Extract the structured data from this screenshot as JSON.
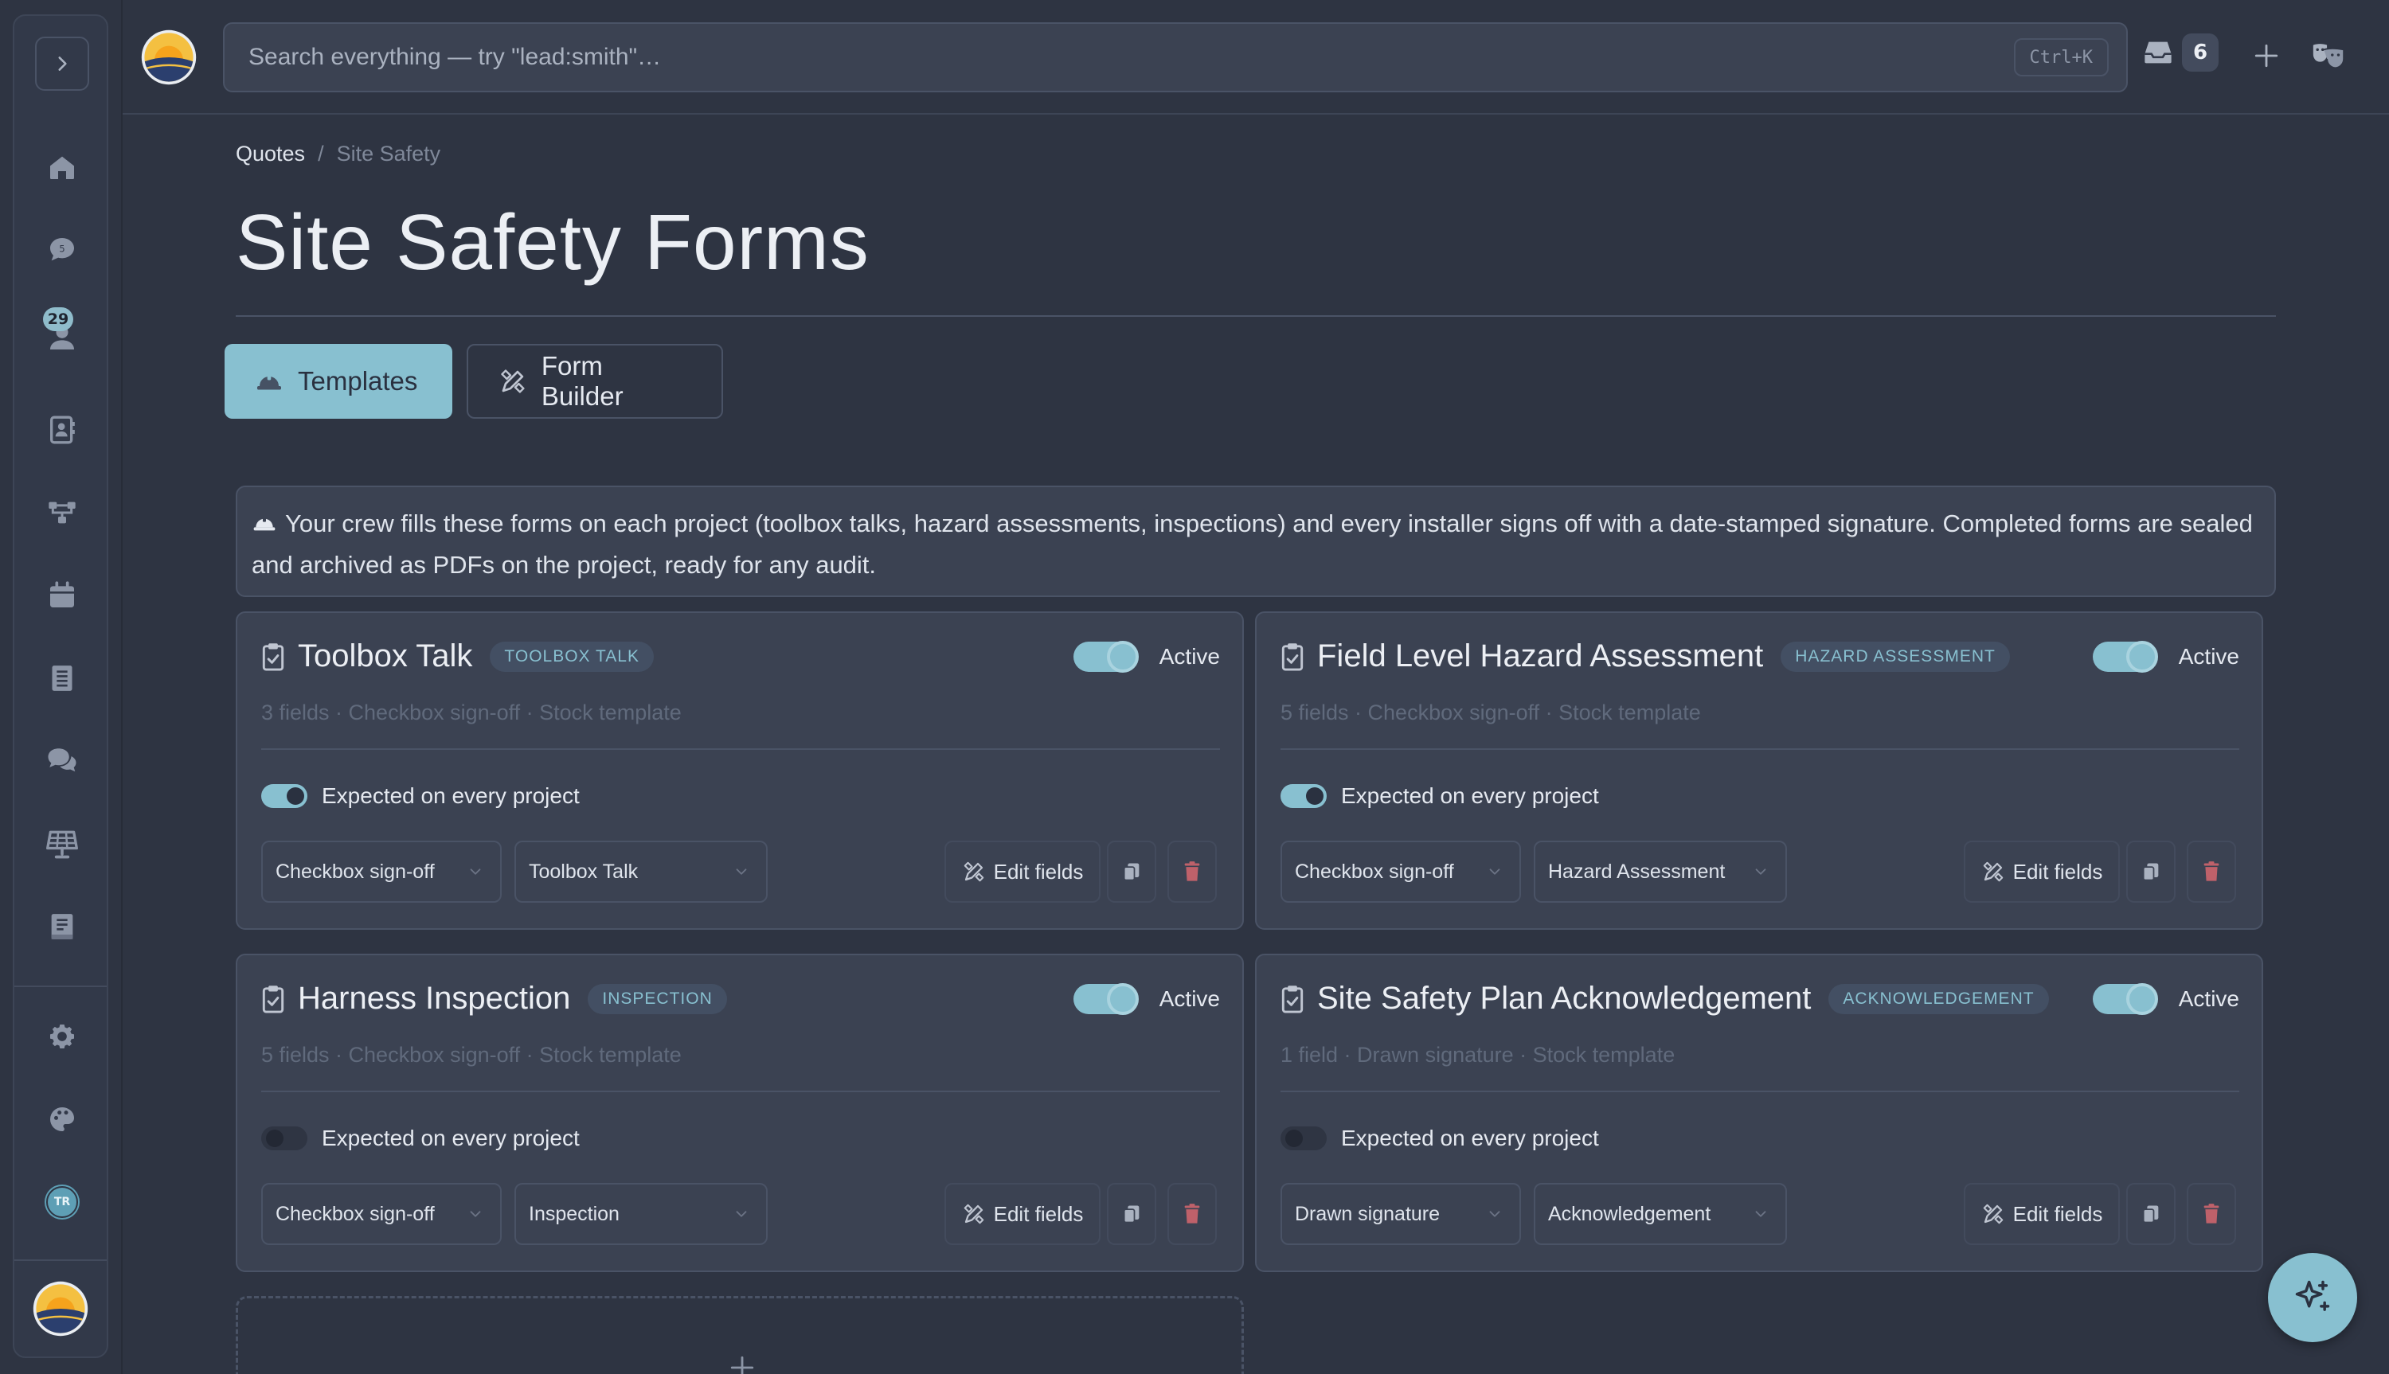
{
  "app": {
    "accent": "#88c0d0",
    "background": "#2e3442",
    "card_bg": "#3b4252",
    "danger": "#bf616a"
  },
  "search": {
    "placeholder": "Search everything — try \"lead:smith\"…",
    "shortcut": "Ctrl+K"
  },
  "header": {
    "inbox_count": "6"
  },
  "sidebar": {
    "items": [
      {
        "name": "home-icon"
      },
      {
        "name": "chat-icon",
        "mini": "5"
      },
      {
        "name": "people-icon",
        "badge": "29"
      },
      {
        "name": "contacts-icon"
      },
      {
        "name": "workflow-icon"
      },
      {
        "name": "calendar-icon"
      },
      {
        "name": "document-icon"
      },
      {
        "name": "messages-icon"
      },
      {
        "name": "solar-panel-icon"
      },
      {
        "name": "book-icon"
      }
    ],
    "bottom": [
      {
        "name": "gear-icon"
      },
      {
        "name": "palette-icon"
      },
      {
        "name": "avatar",
        "initials": "TR"
      }
    ]
  },
  "breadcrumb": {
    "parent": "Quotes",
    "separator": "/",
    "current": "Site Safety"
  },
  "page": {
    "title": "Site Safety Forms"
  },
  "tabs": [
    {
      "label": "Templates",
      "icon": "hard-hat-icon",
      "active": true
    },
    {
      "label": "Form Builder",
      "icon": "pencil-ruler-icon",
      "active": false
    }
  ],
  "info": {
    "icon": "hard-hat-icon",
    "text": "Your crew fills these forms on each project (toolbox talks, hazard assessments, inspections) and every installer signs off with a date-stamped signature. Completed forms are sealed and archived as PDFs on the project, ready for any audit."
  },
  "labels": {
    "active": "Active",
    "expected": "Expected on every project",
    "edit_fields": "Edit fields"
  },
  "cards": [
    {
      "title": "Toolbox Talk",
      "tag": "TOOLBOX TALK",
      "subtitle": "3 fields · Checkbox sign-off · Stock template",
      "active": true,
      "expected": true,
      "signoff": "Checkbox sign-off",
      "category": "Toolbox Talk"
    },
    {
      "title": "Field Level Hazard Assessment",
      "tag": "HAZARD ASSESSMENT",
      "subtitle": "5 fields · Checkbox sign-off · Stock template",
      "active": true,
      "expected": true,
      "signoff": "Checkbox sign-off",
      "category": "Hazard Assessment"
    },
    {
      "title": "Harness Inspection",
      "tag": "INSPECTION",
      "subtitle": "5 fields · Checkbox sign-off · Stock template",
      "active": true,
      "expected": false,
      "signoff": "Checkbox sign-off",
      "category": "Inspection"
    },
    {
      "title": "Site Safety Plan Acknowledgement",
      "tag": "ACKNOWLEDGEMENT",
      "subtitle": "1 field · Drawn signature · Stock template",
      "active": true,
      "expected": false,
      "signoff": "Drawn signature",
      "category": "Acknowledgement"
    }
  ]
}
